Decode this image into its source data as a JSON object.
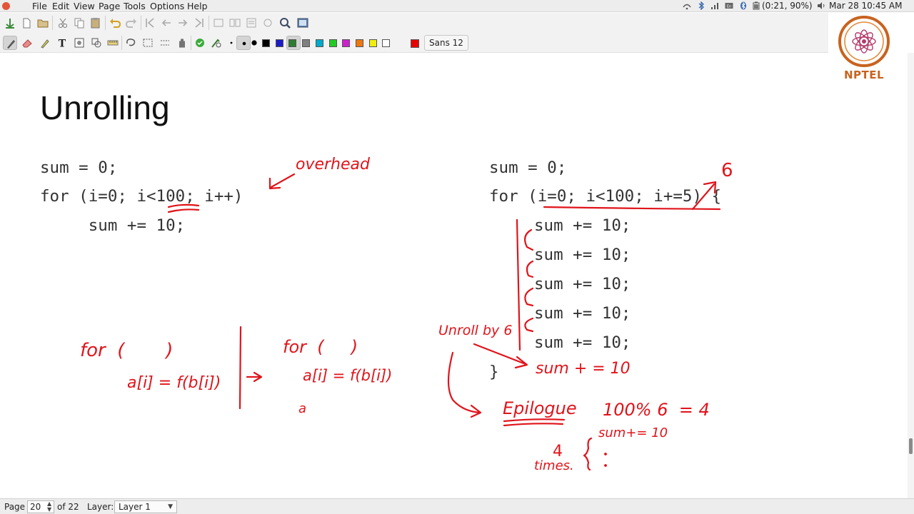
{
  "menubar": {
    "items": [
      "File",
      "Edit",
      "View",
      "Page",
      "Tools",
      "Options",
      "Help"
    ],
    "tray": {
      "battery": "(0:21, 90%)",
      "clock": "Mar 28 10:45 AM"
    }
  },
  "toolbar": {
    "font_label": "Sans  12",
    "colors": [
      "#000000",
      "#1c1cc8",
      "#2f7d2f",
      "#808080",
      "#00aacc",
      "#22cc22",
      "#cc22cc",
      "#ee7711",
      "#eeee11",
      "#ffffff",
      "#e60000"
    ],
    "selected_color": "#e60000"
  },
  "logo": {
    "text": "NPTEL"
  },
  "slide": {
    "title": "Unrolling",
    "left_code": [
      "sum = 0;",
      "for (i=0; i<100; i++)",
      "     sum += 10;"
    ],
    "right_code": [
      "sum = 0;",
      "for (i=0; i<100; i+=5) {",
      "sum += 10;",
      "sum += 10;",
      "sum += 10;",
      "sum += 10;",
      "sum += 10;",
      "}"
    ]
  },
  "annotations": {
    "overhead": "overhead",
    "six": "6",
    "unroll": "Unroll by 6",
    "sum_extra": "sum + = 10",
    "epilogue": "Epilogue",
    "mod": "100% 6  = 4",
    "sum_small": "sum+= 10",
    "four": "4",
    "times": "times.",
    "for1": "for  (       )",
    "body1": "a[i] = f(b[i])",
    "for2": "for  (     )",
    "body2": "a[i] = f(b[i])",
    "a_partial": "a"
  },
  "statusbar": {
    "page_label": "Page",
    "page_value": "20",
    "of_label": "of 22",
    "layer_label": "Layer:",
    "layer_value": "Layer 1"
  }
}
